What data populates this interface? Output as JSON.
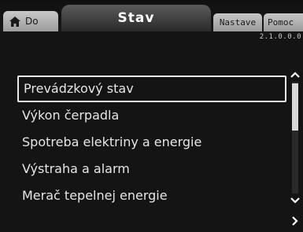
{
  "tabs": {
    "home_label": "Do",
    "active_label": "Stav",
    "nastave_label": "Nastave",
    "pomoc_label": "Pomoc"
  },
  "version": "2.1.0.0.0",
  "menu": {
    "items": [
      {
        "label": "Prevádzkový stav",
        "selected": true
      },
      {
        "label": "Výkon čerpadla",
        "selected": false
      },
      {
        "label": "Spotreba elektriny a energie",
        "selected": false
      },
      {
        "label": "Výstraha a alarm",
        "selected": false
      },
      {
        "label": "Merač tepelnej energie",
        "selected": false
      }
    ]
  },
  "icons": {
    "home": "home-icon",
    "scroll_up": "chevron-up-icon",
    "scroll_down": "chevron-down-icon",
    "next": "chevron-right-icon"
  },
  "colors": {
    "background": "#141414",
    "active_tab": "#4a4a4a",
    "inactive_tab": "#b4b4b4",
    "text": "#e6e6e6"
  }
}
